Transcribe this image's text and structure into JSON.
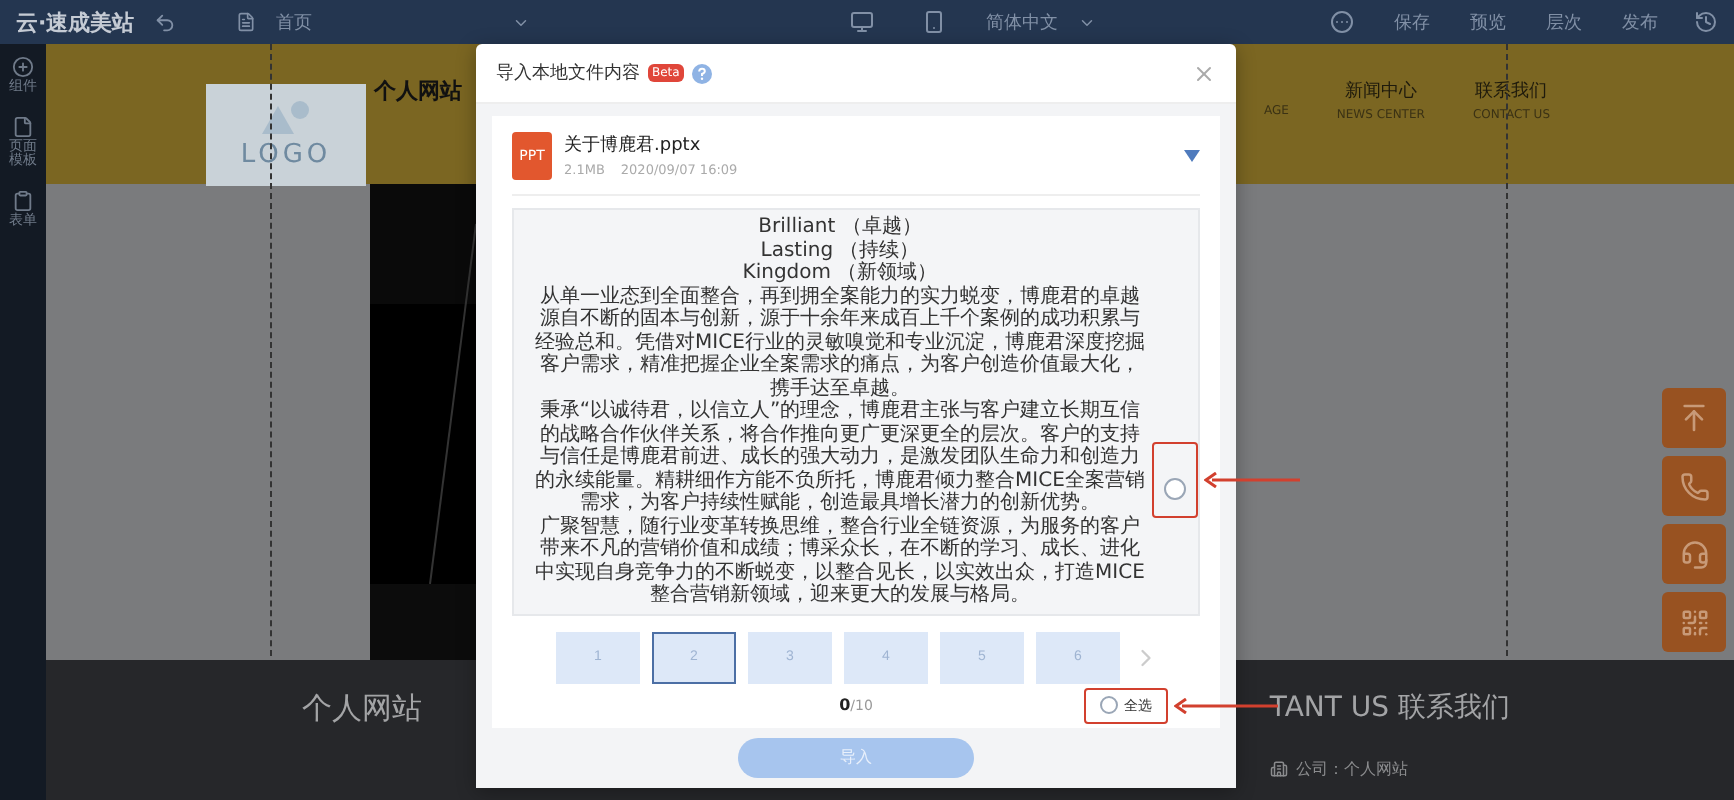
{
  "top_bar": {
    "logo": "云·速成美站",
    "page": "首页",
    "language": "简体中文",
    "actions": [
      "保存",
      "预览",
      "层次",
      "发布"
    ]
  },
  "sidebar": {
    "items": [
      {
        "label": "组件"
      },
      {
        "label": "页面模板"
      },
      {
        "label": "表单"
      }
    ]
  },
  "site": {
    "logo": "LOGO",
    "title": "个人网站",
    "nav": [
      {
        "sublabel": "AGE"
      },
      {
        "label": "新闻中心",
        "sublabel": "NEWS CENTER"
      },
      {
        "label": "联系我们",
        "sublabel": "CONTACT US"
      }
    ]
  },
  "footer": {
    "title": "个人网站",
    "contact_heading": "TANT US 联系我们",
    "company": "公司：个人网站"
  },
  "dialog": {
    "title": "导入本地文件内容",
    "badge": "Beta",
    "file": {
      "type": "PPT",
      "name": "关于博鹿君.pptx",
      "size": "2.1MB",
      "date": "2020/09/07 16:09"
    },
    "preview": {
      "checked": false,
      "paragraphs": [
        "Brilliant （卓越）",
        "Lasting （持续）",
        "Kingdom （新领域）",
        "从单一业态到全面整合，再到拥全案能力的实力蜕变，博鹿君的卓越源自不断的固本与创新，源于十余年来成百上千个案例的成功积累与经验总和。凭借对MICE行业的灵敏嗅觉和专业沉淀，博鹿君深度挖掘客户需求，精准把握企业全案需求的痛点，为客户创造价值最大化，携手达至卓越。",
        "秉承“以诚待君，以信立人”的理念，博鹿君主张与客户建立长期互信的战略合作伙伴关系，将合作推向更广更深更全的层次。客户的支持与信任是博鹿君前进、成长的强大动力，是激发团队生命力和创造力的永续能量。精耕细作方能不负所托，博鹿君倾力整合MICE全案营销需求，为客户持续性赋能，创造最具增长潜力的创新优势。",
        "广聚智慧，随行业变革转换思维，整合行业全链资源，为服务的客户带来不凡的营销价值和成绩；博采众长，在不断的学习、成长、进化中实现自身竞争力的不断蜕变，以整合见长，以实效出众，打造MICE整合营销新领域，迎来更大的发展与格局。"
      ]
    },
    "pages": [
      {
        "label": "1",
        "selected": false
      },
      {
        "label": "2",
        "selected": true
      },
      {
        "label": "3",
        "selected": false
      },
      {
        "label": "4",
        "selected": false
      },
      {
        "label": "5",
        "selected": false
      },
      {
        "label": "6",
        "selected": false
      }
    ],
    "counter": "**0**/10",
    "select_all": {
      "label": "全选",
      "checked": false
    },
    "import_button": "导入"
  }
}
